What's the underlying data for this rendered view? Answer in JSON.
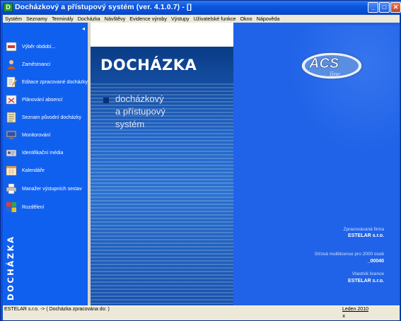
{
  "window": {
    "title": "Docházkový a přístupový systém (ver. 4.1.0.7) - []",
    "app_icon_letter": "D",
    "min_symbol": "_",
    "max_symbol": "□",
    "close_symbol": "✕"
  },
  "menu": {
    "items": [
      "Systém",
      "Seznamy",
      "Terminály",
      "Docházka",
      "Návštěvy",
      "Evidence výroby",
      "Výstupy",
      "Uživatelské funkce",
      "Okno",
      "Nápověda"
    ]
  },
  "sidebar": {
    "collapse_symbol": "◂",
    "items": [
      {
        "label": "Výběr období...",
        "icon": "calendar-range-icon",
        "color": "#d83a2a"
      },
      {
        "label": "Zaměstnanci",
        "icon": "person-icon",
        "color": "#c05a20"
      },
      {
        "label": "Editace zpracované docházky",
        "icon": "edit-sheet-icon",
        "color": "#e0c060"
      },
      {
        "label": "Plánování absencí",
        "icon": "absence-plan-icon",
        "color": "#d04040"
      },
      {
        "label": "Seznam původní docházky",
        "icon": "list-icon",
        "color": "#f0e8c0"
      },
      {
        "label": "Monitorování",
        "icon": "monitor-icon",
        "color": "#a0a8b8"
      },
      {
        "label": "Identifikační média",
        "icon": "id-card-icon",
        "color": "#b0b8c8"
      },
      {
        "label": "Kalendáře",
        "icon": "calendar-icon",
        "color": "#e0a040"
      },
      {
        "label": "Manažer výstupních sestav",
        "icon": "printer-icon",
        "color": "#c8c8c8"
      },
      {
        "label": "Rozdělení",
        "icon": "windows-icon",
        "color": "#40a040"
      }
    ],
    "brand_text": "DOCHÁZKA"
  },
  "center": {
    "banner_title": "DOCHÁZKA",
    "lines": [
      "docházkový",
      "a přístupový",
      "systém"
    ]
  },
  "right": {
    "logo_text": "ACS",
    "logo_sub": "line",
    "company_label": "Zpracovávaná firma",
    "company_value": "ESTELAR s.r.o.",
    "license_label": "Síťová multilicence pro 2000 osob",
    "license_value": "_00040",
    "owner_label": "Vlastník licence",
    "owner_value": "ESTELAR s.r.o."
  },
  "status": {
    "left": "ESTELAR s.r.o.   ->  ( Docházka zpracována do:  )",
    "right": "Leden 2010",
    "x": "x"
  }
}
